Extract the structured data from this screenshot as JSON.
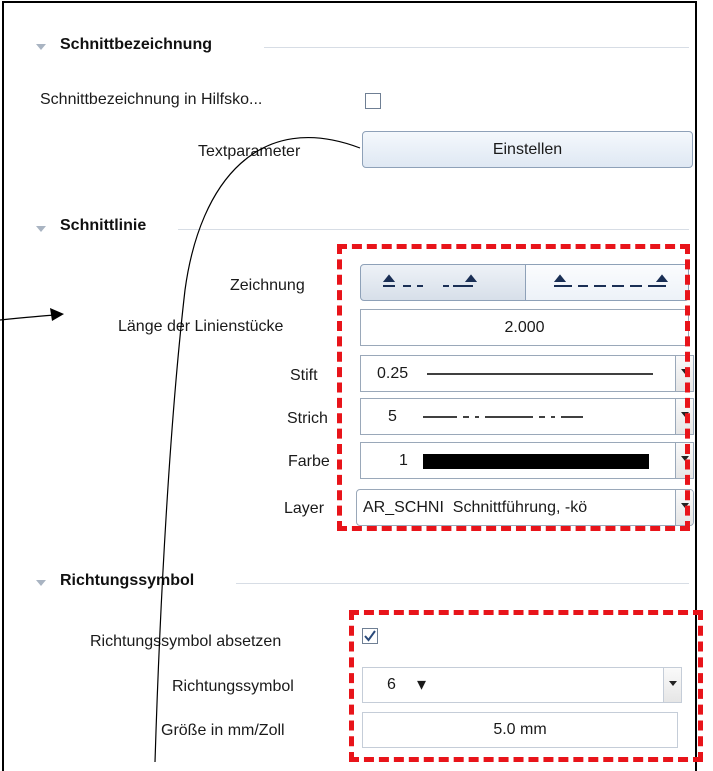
{
  "sections": {
    "schnittbezeichnung": {
      "title": "Schnittbezeichnung",
      "checkbox_label": "Schnittbezeichnung in Hilfsko...",
      "textparam_label": "Textparameter",
      "button_label": "Einstellen"
    },
    "schnittlinie": {
      "title": "Schnittlinie",
      "zeichnung_label": "Zeichnung",
      "laenge_label": "Länge der Linienstücke",
      "laenge_value": "2.000",
      "stift_label": "Stift",
      "stift_value": "0.25",
      "strich_label": "Strich",
      "strich_value": "5",
      "farbe_label": "Farbe",
      "farbe_value": "1",
      "farbe_color": "#000000",
      "layer_label": "Layer",
      "layer_value": "AR_SCHNI  Schnittführung, -kö"
    },
    "richtungssymbol": {
      "title": "Richtungssymbol",
      "absetzen_label": "Richtungssymbol absetzen",
      "absetzen_checked": true,
      "symbol_label": "Richtungssymbol",
      "symbol_value": "6",
      "symbol_glyph": "▾",
      "groesse_label": "Größe in mm/Zoll",
      "groesse_value": "5.0 mm"
    }
  },
  "colors": {
    "highlight": "#e8141a",
    "accent": "#4a6f9c"
  }
}
